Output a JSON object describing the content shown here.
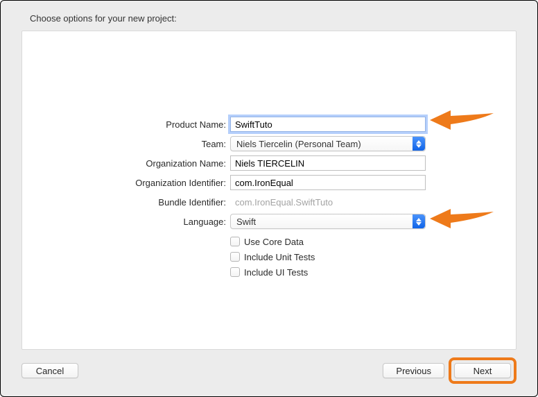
{
  "header": {
    "title": "Choose options for your new project:"
  },
  "form": {
    "product_name": {
      "label": "Product Name:",
      "value": "SwiftTuto"
    },
    "team": {
      "label": "Team:",
      "value": "Niels Tiercelin (Personal Team)"
    },
    "org_name": {
      "label": "Organization Name:",
      "value": "Niels TIERCELIN"
    },
    "org_id": {
      "label": "Organization Identifier:",
      "value": "com.IronEqual"
    },
    "bundle_id": {
      "label": "Bundle Identifier:",
      "value": "com.IronEqual.SwiftTuto"
    },
    "language": {
      "label": "Language:",
      "value": "Swift"
    },
    "use_core_data": {
      "label": "Use Core Data"
    },
    "include_unit": {
      "label": "Include Unit Tests"
    },
    "include_ui": {
      "label": "Include UI Tests"
    }
  },
  "footer": {
    "cancel": "Cancel",
    "previous": "Previous",
    "next": "Next"
  }
}
